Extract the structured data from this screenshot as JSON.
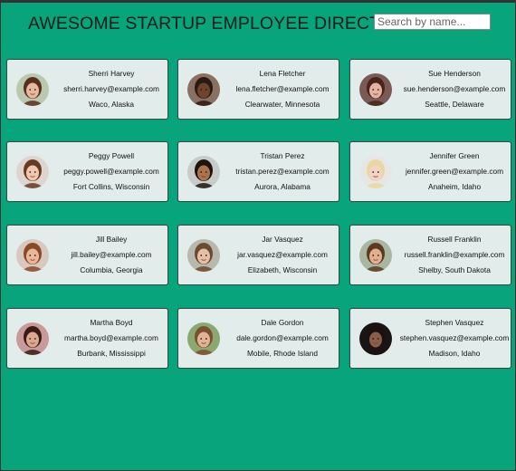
{
  "header": {
    "title": "AWESOME STARTUP EMPLOYEE DIRECTORY",
    "search_placeholder": "Search by name..."
  },
  "employees": [
    {
      "name": "Sherri Harvey",
      "email": "sherri.harvey@example.com",
      "location": "Waco, Alaska",
      "avatar": {
        "skin": "#e6b8a0",
        "hair": "#5a2e1c",
        "bg": "#b9c9b0"
      }
    },
    {
      "name": "Lena Fletcher",
      "email": "lena.fletcher@example.com",
      "location": "Clearwater, Minnesota",
      "avatar": {
        "skin": "#6b4430",
        "hair": "#2a1a12",
        "bg": "#8a7060"
      }
    },
    {
      "name": "Sue Henderson",
      "email": "sue.henderson@example.com",
      "location": "Seattle, Delaware",
      "avatar": {
        "skin": "#e2b4a2",
        "hair": "#4a2418",
        "bg": "#7a5a55"
      }
    },
    {
      "name": "Peggy Powell",
      "email": "peggy.powell@example.com",
      "location": "Fort Collins, Wisconsin",
      "avatar": {
        "skin": "#f0c8b0",
        "hair": "#6a3a20",
        "bg": "#ddd6d0"
      }
    },
    {
      "name": "Tristan Perez",
      "email": "tristan.perez@example.com",
      "location": "Aurora, Alabama",
      "avatar": {
        "skin": "#a8754e",
        "hair": "#1e140e",
        "bg": "#c8ccc8"
      }
    },
    {
      "name": "Jennifer Green",
      "email": "jennifer.green@example.com",
      "location": "Anaheim, Idaho",
      "avatar": {
        "skin": "#f2d4c4",
        "hair": "#e8d8a0",
        "bg": "#e8e6e4"
      }
    },
    {
      "name": "Jill Bailey",
      "email": "jill.bailey@example.com",
      "location": "Columbia, Georgia",
      "avatar": {
        "skin": "#e8b898",
        "hair": "#8a4a28",
        "bg": "#d8c8c0"
      }
    },
    {
      "name": "Jar Vasquez",
      "email": "jar.vasquez@example.com",
      "location": "Elizabeth, Wisconsin",
      "avatar": {
        "skin": "#e6c0a6",
        "hair": "#6a4a30",
        "bg": "#b8b8ac"
      }
    },
    {
      "name": "Russell Franklin",
      "email": "russell.franklin@example.com",
      "location": "Shelby, South Dakota",
      "avatar": {
        "skin": "#e2b090",
        "hair": "#5a3a20",
        "bg": "#a8b8a0"
      }
    },
    {
      "name": "Martha Boyd",
      "email": "martha.boyd@example.com",
      "location": "Burbank, Mississippi",
      "avatar": {
        "skin": "#dca890",
        "hair": "#3a1c14",
        "bg": "#c89a9a"
      }
    },
    {
      "name": "Dale Gordon",
      "email": "dale.gordon@example.com",
      "location": "Mobile, Rhode Island",
      "avatar": {
        "skin": "#e0b494",
        "hair": "#7a5030",
        "bg": "#8aa870"
      }
    },
    {
      "name": "Stephen Vasquez",
      "email": "stephen.vasquez@example.com",
      "location": "Madison, Idaho",
      "avatar": {
        "skin": "#8a5e48",
        "hair": "#1a1210",
        "bg": "#1a1414"
      }
    }
  ]
}
